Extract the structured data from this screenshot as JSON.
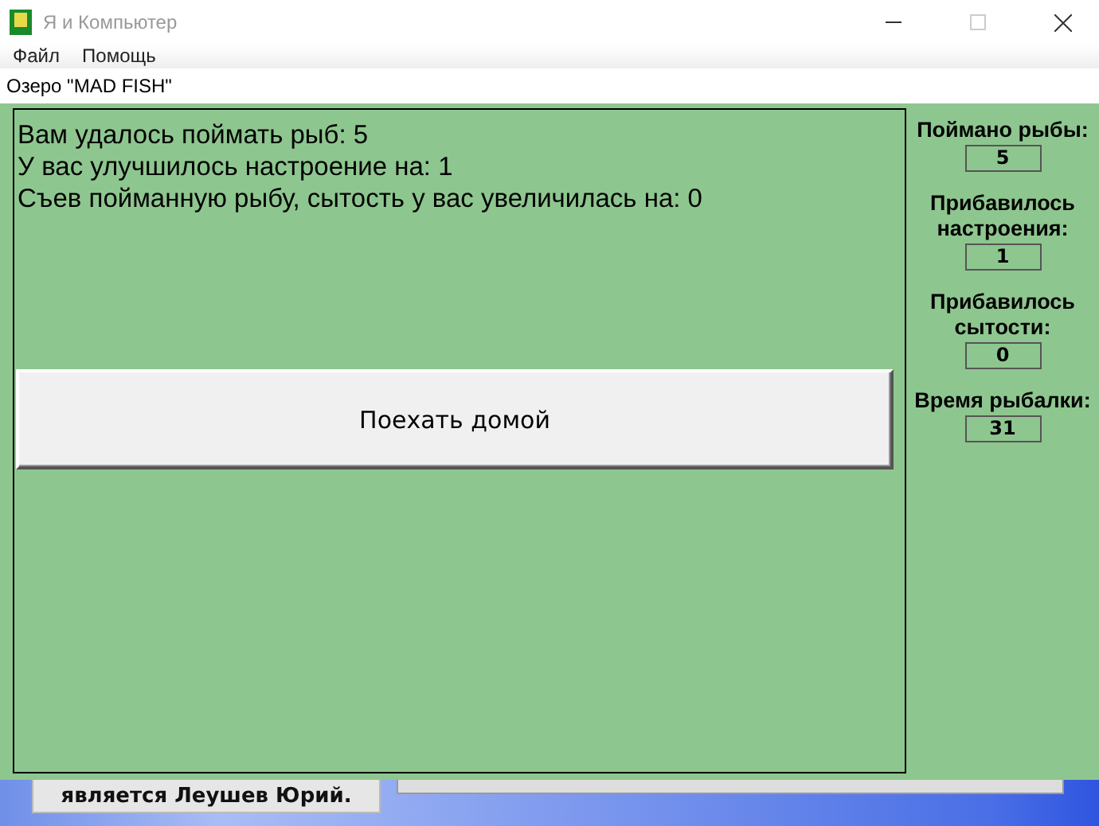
{
  "window": {
    "title": "Я и Компьютер"
  },
  "menu": [
    {
      "label": "Файл"
    },
    {
      "label": "Помощь"
    }
  ],
  "location": "Озеро \"MAD FISH\"",
  "messages": [
    "Вам удалось поймать рыб: 5",
    "У вас улучшилось настроение на: 1",
    "Съев пойманную рыбу, сытость у вас увеличилась на: 0"
  ],
  "action_button": "Поехать домой",
  "stats": [
    {
      "label": "Поймано рыбы:",
      "value": "5"
    },
    {
      "label": "Прибавилось настроения:",
      "value": "1"
    },
    {
      "label": "Прибавилось сытости:",
      "value": "0"
    },
    {
      "label": "Время рыбалки:",
      "value": "31"
    }
  ],
  "background_window": {
    "label": "является Леушев Юрий."
  }
}
